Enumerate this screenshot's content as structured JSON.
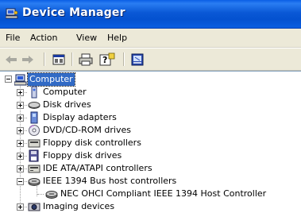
{
  "window": {
    "title": "Device Manager"
  },
  "menu": {
    "items": [
      "File",
      "Action",
      "View",
      "Help"
    ]
  },
  "toolbar": {
    "buttons": [
      "back-arrow-icon",
      "forward-arrow-icon",
      "properties-icon",
      "print-icon",
      "help-icon",
      "scan-hardware-icon"
    ]
  },
  "tree": {
    "root": {
      "label": "Computer",
      "expanded": true,
      "selected": true
    },
    "items": [
      {
        "label": "Computer",
        "icon": "computer-icon",
        "expanded": false
      },
      {
        "label": "Disk drives",
        "icon": "disk-drive-icon",
        "expanded": false
      },
      {
        "label": "Display adapters",
        "icon": "display-adapter-icon",
        "expanded": false
      },
      {
        "label": "DVD/CD-ROM drives",
        "icon": "dvd-drive-icon",
        "expanded": false
      },
      {
        "label": "Floppy disk controllers",
        "icon": "floppy-controller-icon",
        "expanded": false
      },
      {
        "label": "Floppy disk drives",
        "icon": "floppy-drive-icon",
        "expanded": false
      },
      {
        "label": "IDE ATA/ATAPI controllers",
        "icon": "ide-controller-icon",
        "expanded": false
      },
      {
        "label": "IEEE 1394 Bus host controllers",
        "icon": "ieee1394-icon",
        "expanded": true,
        "children": [
          {
            "label": "NEC OHCI Compliant IEEE 1394 Host Controller",
            "icon": "ieee1394-icon"
          }
        ]
      },
      {
        "label": "Imaging devices",
        "icon": "imaging-device-icon",
        "expanded": false
      }
    ]
  }
}
